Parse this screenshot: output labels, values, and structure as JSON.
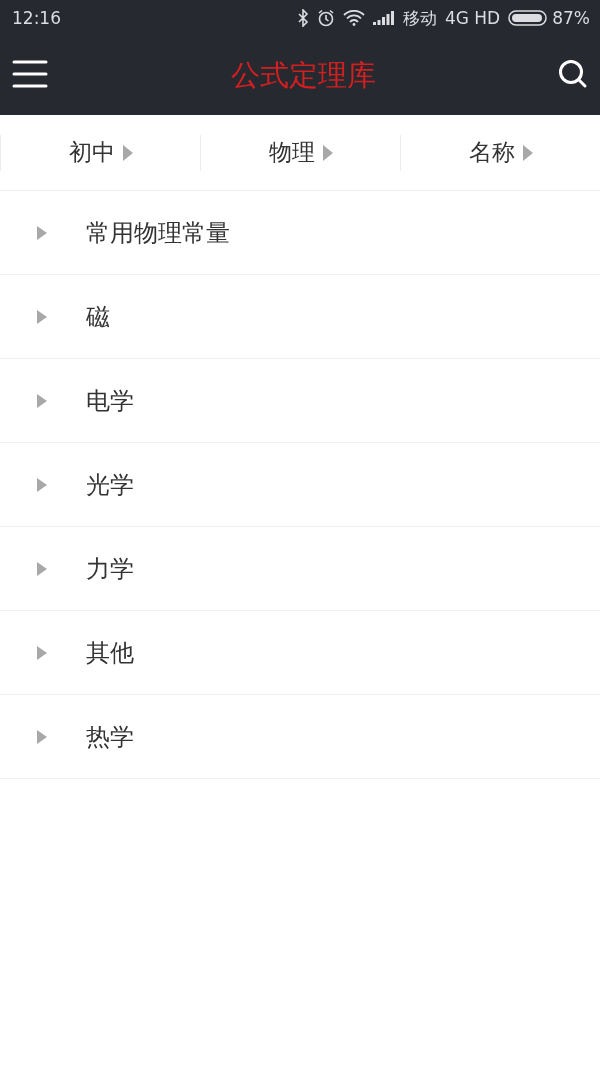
{
  "status_bar": {
    "time": "12:16",
    "carrier": "移动",
    "network": "4G HD",
    "battery": "87%"
  },
  "header": {
    "title": "公式定理库"
  },
  "filters": [
    {
      "label": "初中"
    },
    {
      "label": "物理"
    },
    {
      "label": "名称"
    }
  ],
  "categories": [
    {
      "label": "常用物理常量",
      "expanded": false
    },
    {
      "label": "磁",
      "expanded": false
    },
    {
      "label": "电学",
      "expanded": false
    },
    {
      "label": "光学",
      "expanded": false
    },
    {
      "label": "力学",
      "expanded": false
    },
    {
      "label": "其他",
      "expanded": false
    },
    {
      "label": "热学",
      "expanded": false
    }
  ]
}
